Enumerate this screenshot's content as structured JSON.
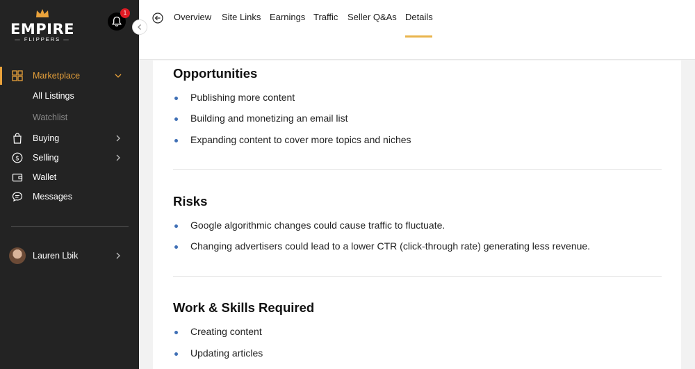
{
  "brand": {
    "name": "EMPIRE",
    "tagline": "FLIPPERS"
  },
  "notifications": {
    "count": "1"
  },
  "sidebar": {
    "marketplace": "Marketplace",
    "sub_items": [
      "All Listings",
      "Watchlist"
    ],
    "items": [
      {
        "label": "Buying",
        "icon": "shopping-bag-icon"
      },
      {
        "label": "Selling",
        "icon": "dollar-circle-icon"
      },
      {
        "label": "Wallet",
        "icon": "wallet-icon"
      },
      {
        "label": "Messages",
        "icon": "chat-icon"
      }
    ],
    "user": {
      "name": "Lauren Lbik"
    }
  },
  "topnav": {
    "tabs": [
      "Overview",
      "Site Links",
      "Earnings",
      "Traffic",
      "Seller Q&As",
      "Details"
    ],
    "active_tab": "Details"
  },
  "sections": [
    {
      "title": "Opportunities",
      "items": [
        "Publishing more content",
        "Building and monetizing an email list",
        "Expanding content to cover more topics and niches"
      ]
    },
    {
      "title": "Risks",
      "items": [
        "Google algorithmic changes could cause traffic to fluctuate.",
        "Changing advertisers could lead to a lower CTR (click-through rate) generating less revenue."
      ]
    },
    {
      "title": "Work & Skills Required",
      "items": [
        "Creating content",
        "Updating articles"
      ]
    }
  ],
  "colors": {
    "accent": "#e9a23b",
    "sidebar_bg": "#232323",
    "bullet": "#3f6fb5",
    "tab_underline": "#e9b44c"
  }
}
